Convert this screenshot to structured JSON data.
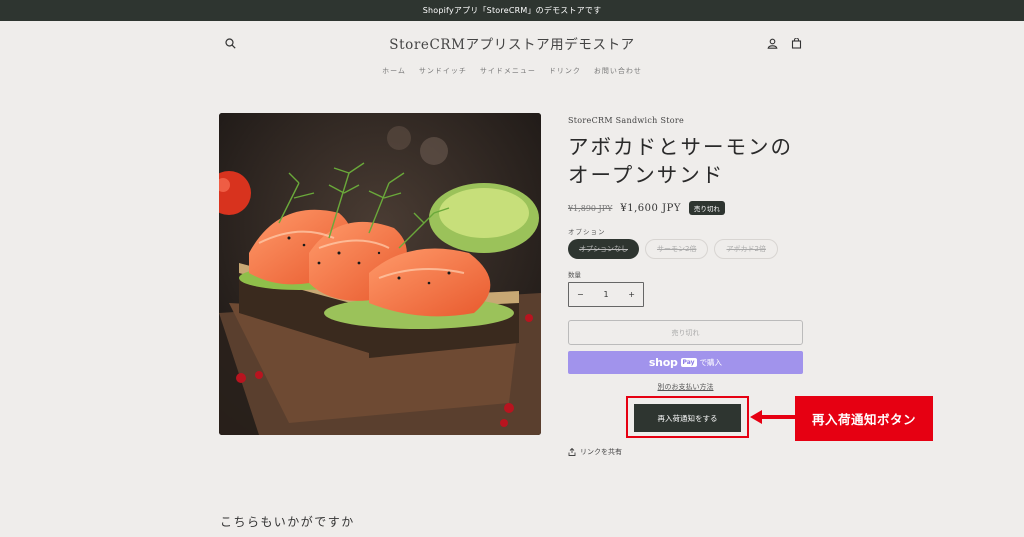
{
  "announcement": "Shopifyアプリ「StoreCRM」のデモストアです",
  "header": {
    "store_title": "StoreCRMアプリストア用デモストア",
    "icons": {
      "search": "search-icon",
      "account": "account-icon",
      "cart": "cart-icon"
    }
  },
  "nav": {
    "items": [
      "ホーム",
      "サンドイッチ",
      "サイドメニュー",
      "ドリンク",
      "お問い合わせ"
    ]
  },
  "product": {
    "vendor": "StoreCRM Sandwich Store",
    "title_line1": "アボカドとサーモンの",
    "title_line2": "オープンサンド",
    "price_old": "¥1,890 JPY",
    "price_new": "¥1,600 JPY",
    "badge": "売り切れ",
    "option_label": "オプション",
    "options": [
      "オプションなし",
      "サーモン2倍",
      "アボカド2倍"
    ],
    "selected_option": "オプションなし",
    "qty_label": "数量",
    "qty_value": "1",
    "qty_minus": "−",
    "qty_plus": "+",
    "soldout_button": "売り切れ",
    "shoppay_shop": "shop",
    "shoppay_pay": "Pay",
    "shoppay_buy": "で購入",
    "more_payment": "別のお支払い方法",
    "restock_button": "再入荷通知をする",
    "share": "リンクを共有"
  },
  "callout": {
    "label": "再入荷通知ボタン",
    "color": "#e60012"
  },
  "recommend_title": "こちらもいかがですか",
  "colors": {
    "dark": "#2e3530",
    "bg": "#efedeb",
    "shoppay": "#a193ec"
  }
}
